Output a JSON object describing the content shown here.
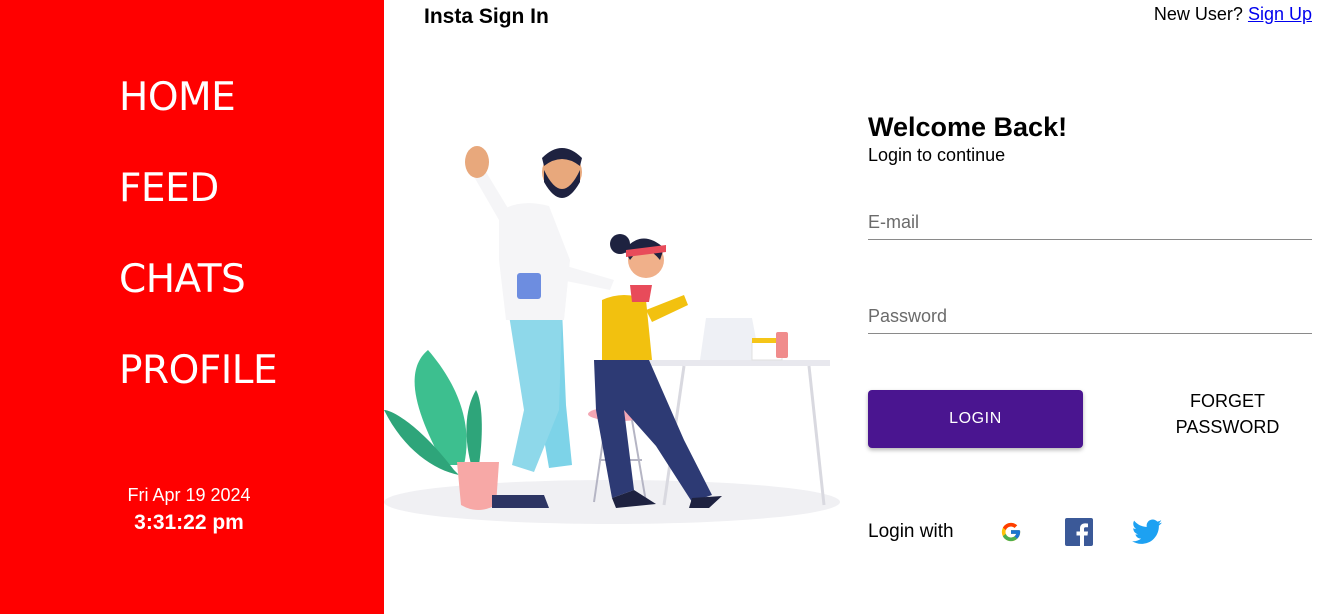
{
  "sidebar": {
    "color": "#ff0000",
    "nav": [
      {
        "label": "HOME"
      },
      {
        "label": "FEED"
      },
      {
        "label": "CHATS"
      },
      {
        "label": "PROFILE"
      }
    ],
    "date": "Fri Apr 19 2024",
    "time": "3:31:22 pm"
  },
  "header": {
    "brand": "Insta Sign In",
    "new_user_text": "New User?",
    "signup_link": "Sign Up"
  },
  "form": {
    "title": "Welcome Back!",
    "subtitle": "Login to continue",
    "email_placeholder": "E-mail",
    "password_placeholder": "Password",
    "login_button": "LOGIN",
    "forget_line1": "FORGET",
    "forget_line2": "PASSWORD",
    "login_with": "Login with",
    "button_color": "#4a1590"
  },
  "icons": {
    "google": "google-icon",
    "facebook": "facebook-icon",
    "twitter": "twitter-icon"
  }
}
